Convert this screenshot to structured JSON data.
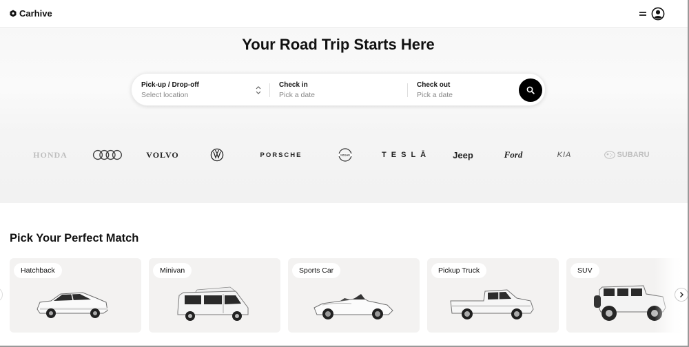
{
  "header": {
    "brand_name": "Carhive",
    "icons": [
      "logo-hexagon-icon",
      "hamburger-menu-icon",
      "user-profile-icon"
    ]
  },
  "hero": {
    "title": "Your Road Trip Starts Here",
    "search": {
      "pickup_label": "Pick-up / Drop-off",
      "pickup_placeholder": "Select location",
      "checkin_label": "Check in",
      "checkin_placeholder": "Pick a date",
      "checkout_label": "Check out",
      "checkout_placeholder": "Pick a date"
    }
  },
  "brands": {
    "items": [
      "HONDA",
      "Audi",
      "VOLVO",
      "Volkswagen",
      "PORSCHE",
      "NISSAN",
      "TESLA",
      "Jeep",
      "Ford",
      "KIA",
      "SUBARU"
    ],
    "text": {
      "honda": "HONDA",
      "volvo": "VOLVO",
      "porsche": "PORSCHE",
      "nissan": "NISSAN",
      "tesla": "T E S L Ā",
      "jeep": "Jeep",
      "ford": "Ford",
      "kia": "KIA",
      "subaru": "SUBARU"
    }
  },
  "match": {
    "title": "Pick Your Perfect Match",
    "cards": [
      {
        "label": "Hatchback"
      },
      {
        "label": "Minivan"
      },
      {
        "label": "Sports Car"
      },
      {
        "label": "Pickup Truck"
      },
      {
        "label": "SUV"
      }
    ]
  },
  "colors": {
    "accent": "#000000",
    "card_bg": "#f3f2f1",
    "hero_bg": "#f7f7f7",
    "muted_text": "#888888"
  }
}
